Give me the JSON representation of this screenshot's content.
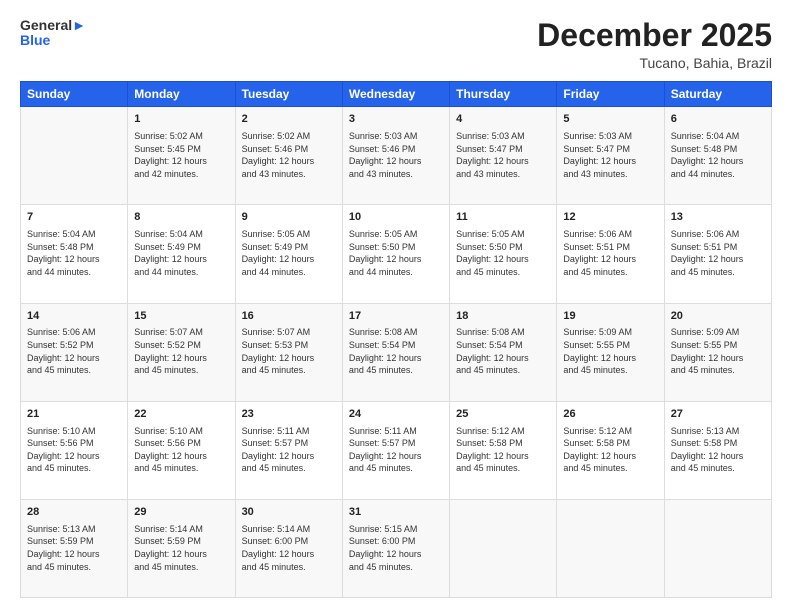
{
  "header": {
    "logo_line1": "General",
    "logo_line2": "Blue",
    "title": "December 2025",
    "subtitle": "Tucano, Bahia, Brazil"
  },
  "columns": [
    "Sunday",
    "Monday",
    "Tuesday",
    "Wednesday",
    "Thursday",
    "Friday",
    "Saturday"
  ],
  "rows": [
    [
      {
        "day": "",
        "lines": []
      },
      {
        "day": "1",
        "lines": [
          "Sunrise: 5:02 AM",
          "Sunset: 5:45 PM",
          "Daylight: 12 hours",
          "and 42 minutes."
        ]
      },
      {
        "day": "2",
        "lines": [
          "Sunrise: 5:02 AM",
          "Sunset: 5:46 PM",
          "Daylight: 12 hours",
          "and 43 minutes."
        ]
      },
      {
        "day": "3",
        "lines": [
          "Sunrise: 5:03 AM",
          "Sunset: 5:46 PM",
          "Daylight: 12 hours",
          "and 43 minutes."
        ]
      },
      {
        "day": "4",
        "lines": [
          "Sunrise: 5:03 AM",
          "Sunset: 5:47 PM",
          "Daylight: 12 hours",
          "and 43 minutes."
        ]
      },
      {
        "day": "5",
        "lines": [
          "Sunrise: 5:03 AM",
          "Sunset: 5:47 PM",
          "Daylight: 12 hours",
          "and 43 minutes."
        ]
      },
      {
        "day": "6",
        "lines": [
          "Sunrise: 5:04 AM",
          "Sunset: 5:48 PM",
          "Daylight: 12 hours",
          "and 44 minutes."
        ]
      }
    ],
    [
      {
        "day": "7",
        "lines": [
          "Sunrise: 5:04 AM",
          "Sunset: 5:48 PM",
          "Daylight: 12 hours",
          "and 44 minutes."
        ]
      },
      {
        "day": "8",
        "lines": [
          "Sunrise: 5:04 AM",
          "Sunset: 5:49 PM",
          "Daylight: 12 hours",
          "and 44 minutes."
        ]
      },
      {
        "day": "9",
        "lines": [
          "Sunrise: 5:05 AM",
          "Sunset: 5:49 PM",
          "Daylight: 12 hours",
          "and 44 minutes."
        ]
      },
      {
        "day": "10",
        "lines": [
          "Sunrise: 5:05 AM",
          "Sunset: 5:50 PM",
          "Daylight: 12 hours",
          "and 44 minutes."
        ]
      },
      {
        "day": "11",
        "lines": [
          "Sunrise: 5:05 AM",
          "Sunset: 5:50 PM",
          "Daylight: 12 hours",
          "and 45 minutes."
        ]
      },
      {
        "day": "12",
        "lines": [
          "Sunrise: 5:06 AM",
          "Sunset: 5:51 PM",
          "Daylight: 12 hours",
          "and 45 minutes."
        ]
      },
      {
        "day": "13",
        "lines": [
          "Sunrise: 5:06 AM",
          "Sunset: 5:51 PM",
          "Daylight: 12 hours",
          "and 45 minutes."
        ]
      }
    ],
    [
      {
        "day": "14",
        "lines": [
          "Sunrise: 5:06 AM",
          "Sunset: 5:52 PM",
          "Daylight: 12 hours",
          "and 45 minutes."
        ]
      },
      {
        "day": "15",
        "lines": [
          "Sunrise: 5:07 AM",
          "Sunset: 5:52 PM",
          "Daylight: 12 hours",
          "and 45 minutes."
        ]
      },
      {
        "day": "16",
        "lines": [
          "Sunrise: 5:07 AM",
          "Sunset: 5:53 PM",
          "Daylight: 12 hours",
          "and 45 minutes."
        ]
      },
      {
        "day": "17",
        "lines": [
          "Sunrise: 5:08 AM",
          "Sunset: 5:54 PM",
          "Daylight: 12 hours",
          "and 45 minutes."
        ]
      },
      {
        "day": "18",
        "lines": [
          "Sunrise: 5:08 AM",
          "Sunset: 5:54 PM",
          "Daylight: 12 hours",
          "and 45 minutes."
        ]
      },
      {
        "day": "19",
        "lines": [
          "Sunrise: 5:09 AM",
          "Sunset: 5:55 PM",
          "Daylight: 12 hours",
          "and 45 minutes."
        ]
      },
      {
        "day": "20",
        "lines": [
          "Sunrise: 5:09 AM",
          "Sunset: 5:55 PM",
          "Daylight: 12 hours",
          "and 45 minutes."
        ]
      }
    ],
    [
      {
        "day": "21",
        "lines": [
          "Sunrise: 5:10 AM",
          "Sunset: 5:56 PM",
          "Daylight: 12 hours",
          "and 45 minutes."
        ]
      },
      {
        "day": "22",
        "lines": [
          "Sunrise: 5:10 AM",
          "Sunset: 5:56 PM",
          "Daylight: 12 hours",
          "and 45 minutes."
        ]
      },
      {
        "day": "23",
        "lines": [
          "Sunrise: 5:11 AM",
          "Sunset: 5:57 PM",
          "Daylight: 12 hours",
          "and 45 minutes."
        ]
      },
      {
        "day": "24",
        "lines": [
          "Sunrise: 5:11 AM",
          "Sunset: 5:57 PM",
          "Daylight: 12 hours",
          "and 45 minutes."
        ]
      },
      {
        "day": "25",
        "lines": [
          "Sunrise: 5:12 AM",
          "Sunset: 5:58 PM",
          "Daylight: 12 hours",
          "and 45 minutes."
        ]
      },
      {
        "day": "26",
        "lines": [
          "Sunrise: 5:12 AM",
          "Sunset: 5:58 PM",
          "Daylight: 12 hours",
          "and 45 minutes."
        ]
      },
      {
        "day": "27",
        "lines": [
          "Sunrise: 5:13 AM",
          "Sunset: 5:58 PM",
          "Daylight: 12 hours",
          "and 45 minutes."
        ]
      }
    ],
    [
      {
        "day": "28",
        "lines": [
          "Sunrise: 5:13 AM",
          "Sunset: 5:59 PM",
          "Daylight: 12 hours",
          "and 45 minutes."
        ]
      },
      {
        "day": "29",
        "lines": [
          "Sunrise: 5:14 AM",
          "Sunset: 5:59 PM",
          "Daylight: 12 hours",
          "and 45 minutes."
        ]
      },
      {
        "day": "30",
        "lines": [
          "Sunrise: 5:14 AM",
          "Sunset: 6:00 PM",
          "Daylight: 12 hours",
          "and 45 minutes."
        ]
      },
      {
        "day": "31",
        "lines": [
          "Sunrise: 5:15 AM",
          "Sunset: 6:00 PM",
          "Daylight: 12 hours",
          "and 45 minutes."
        ]
      },
      {
        "day": "",
        "lines": []
      },
      {
        "day": "",
        "lines": []
      },
      {
        "day": "",
        "lines": []
      }
    ]
  ]
}
